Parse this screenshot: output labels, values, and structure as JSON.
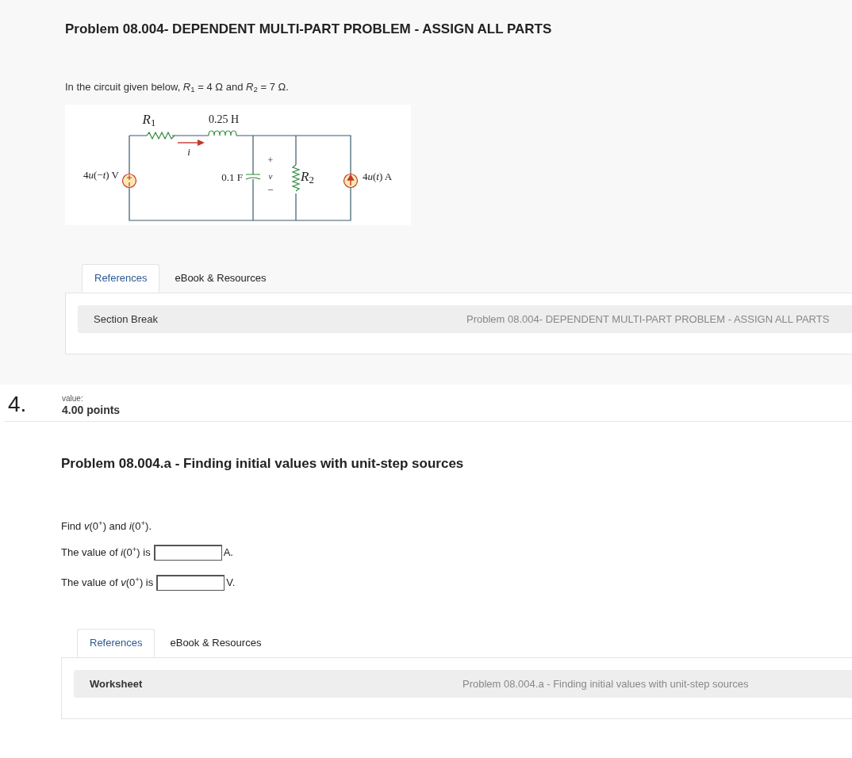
{
  "header": {
    "title": "Problem 08.004- DEPENDENT MULTI-PART PROBLEM - ASSIGN ALL PARTS"
  },
  "intro": "In the circuit given below, *R*$_{1}$ = 4 Ω and *R*$_{2}$ = 7 Ω.",
  "circuit": {
    "labels": [
      {
        "kind": "r1",
        "text": "*R*$_{1}$"
      },
      {
        "kind": "inductor",
        "text": "0.25 H"
      },
      {
        "kind": "current",
        "text": "*i*"
      },
      {
        "kind": "vsource",
        "parts": [
          {
            "text": "4",
            "italic": false
          },
          {
            "text": "u",
            "italic": true
          },
          {
            "text": "(−",
            "italic": false
          },
          {
            "text": "t",
            "italic": true
          },
          {
            "text": ") V",
            "italic": false
          }
        ]
      },
      {
        "kind": "capacitor",
        "text": "0.1 F"
      },
      {
        "kind": "plus",
        "text": "+"
      },
      {
        "kind": "voltage",
        "text": "*v*"
      },
      {
        "kind": "minus",
        "text": "−"
      },
      {
        "kind": "r2",
        "text": "*R*$_{2}$"
      },
      {
        "kind": "isource",
        "parts": [
          {
            "text": "4",
            "italic": false
          },
          {
            "text": "u",
            "italic": true
          },
          {
            "text": "(",
            "italic": false
          },
          {
            "text": "t",
            "italic": true
          },
          {
            "text": ") A",
            "italic": false
          }
        ]
      }
    ]
  },
  "references_1": {
    "tabs": [
      {
        "label": "References",
        "selected": true
      },
      {
        "label": "eBook & Resources",
        "selected": false
      }
    ],
    "section_label": "Section Break",
    "section_title": "Problem 08.004- DEPENDENT MULTI-PART PROBLEM - ASSIGN ALL PARTS"
  },
  "question": {
    "number": "4.",
    "value_label": "value:",
    "points": "4.00 points",
    "title": "Problem 08.004.a - Finding initial values with unit-step sources",
    "prompt": "Find *v*(0$^{+}$) and *i*(0$^{+}$).",
    "answers": [
      {
        "label": "The value of *i*(0$^{+}$) is",
        "unit": "A."
      },
      {
        "label": "The value of *v*(0$^{+}$) is",
        "unit": "V."
      }
    ]
  },
  "references_2": {
    "tabs": [
      {
        "label": "References",
        "selected": true
      },
      {
        "label": "eBook & Resources",
        "selected": false
      }
    ],
    "section_label": "Worksheet",
    "section_title": "Problem 08.004.a - Finding initial values with unit-step sources"
  }
}
